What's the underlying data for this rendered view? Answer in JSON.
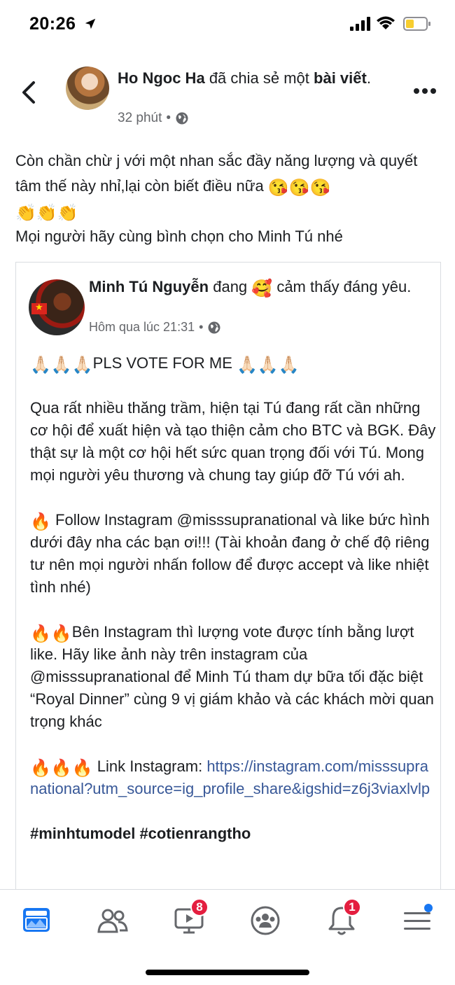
{
  "status_bar": {
    "time": "20:26"
  },
  "post": {
    "author": "Ho Ngoc Ha",
    "action_prefix": "đã chia sẻ một",
    "action_object": "bài viết",
    "action_suffix": ".",
    "time": "32 phút",
    "meta_separator": "•",
    "text_line1": "Còn chần chừ j với một nhan sắc đầy năng lượng và quyết tâm thế này nhỉ,lại còn biết điều nữa",
    "emoji_kiss": "😘😘😘",
    "emoji_clap": "👏👏👏",
    "text_line2": "Mọi người hãy cùng bình chọn cho Minh Tú nhé"
  },
  "shared_post": {
    "author": "Minh Tú Nguyễn",
    "feeling_prefix": "đang",
    "feeling_emoji": "🥰",
    "feeling_text": "cảm thấy đáng yêu.",
    "time": "Hôm qua lúc 21:31",
    "meta_separator": "•",
    "pray_emoji": "🙏🏻🙏🏻🙏🏻",
    "vote_title": "PLS VOTE FOR ME",
    "paragraph1": "Qua rất nhiều thăng trầm, hiện tại Tú đang rất cần những cơ hội để xuất hiện và tạo thiện cảm cho BTC và BGK.  Đây thật sự là một cơ hội hết sức quan trọng đối với Tú. Mong mọi người yêu thương và chung tay giúp đỡ Tú với ah.",
    "fire1": "🔥",
    "paragraph2": "Follow Instagram @misssupranational  và like bức hình dưới đây nha các bạn ơi!!! (Tài khoản đang ở chế độ riêng tư nên mọi người nhấn follow để được accept và like nhiệt tình nhé)",
    "fire2": "🔥🔥",
    "paragraph3": "Bên Instagram thì lượng vote được tính bằng lượt like. Hãy like ảnh này trên instagram của @misssupranational để Minh Tú tham dự bữa tối đặc biệt “Royal Dinner” cùng 9 vị giám khảo và các khách mời quan trọng khác",
    "fire3": "🔥🔥🔥",
    "link_label": "Link Instagram:",
    "link_url": "https://instagram.com/misssupranational?utm_source=ig_profile_share&igshid=z6j3viaxlvlp",
    "hashtags": "#minhtumodel #cotienrangtho"
  },
  "bottom_nav": {
    "video_badge": "8",
    "notifications_badge": "1",
    "items": [
      "feed-icon",
      "friends-icon",
      "watch-icon",
      "groups-icon",
      "notifications-icon",
      "menu-icon"
    ]
  },
  "colors": {
    "link": "#385898",
    "badge": "#e41e3f",
    "dot": "#1877f2",
    "battery_fill": "#f7cd2f"
  }
}
